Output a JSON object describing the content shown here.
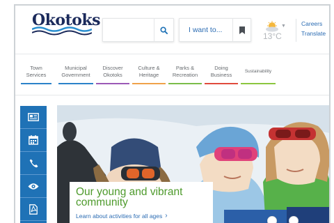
{
  "header": {
    "logo_text": "Okotoks",
    "search": {
      "placeholder": ""
    },
    "i_want_to_label": "I want to...",
    "weather": {
      "temperature": "13°C",
      "icon": "partly-cloudy-icon"
    },
    "links": [
      "Careers",
      "Translate"
    ]
  },
  "nav": {
    "items": [
      {
        "label_line1": "Town",
        "label_line2": "Services",
        "color": "#2b82c9"
      },
      {
        "label_line1": "Municipal",
        "label_line2": "Government",
        "color": "#2b82c9"
      },
      {
        "label_line1": "Discover",
        "label_line2": "Okotoks",
        "color": "#9b59b6"
      },
      {
        "label_line1": "Culture &",
        "label_line2": "Heritage",
        "color": "#f0a24a"
      },
      {
        "label_line1": "Parks &",
        "label_line2": "Recreation",
        "color": "#7bbd4a"
      },
      {
        "label_line1": "Doing",
        "label_line2": "Business",
        "color": "#e04b3c"
      },
      {
        "label_line1": "",
        "label_line2": "Sustainability",
        "color": "#8cc63f"
      }
    ]
  },
  "sidebar": {
    "items": [
      {
        "icon": "news-icon"
      },
      {
        "icon": "calendar-icon"
      },
      {
        "icon": "phone-icon"
      },
      {
        "icon": "eye-icon"
      },
      {
        "icon": "pdf-icon"
      }
    ]
  },
  "hero": {
    "title": "Our young and vibrant community",
    "link": "Learn about activities for all ages",
    "slides": 2,
    "active_slide": 1
  }
}
